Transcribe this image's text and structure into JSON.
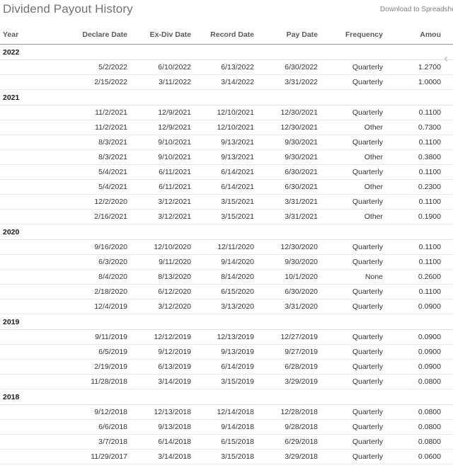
{
  "header": {
    "title": "Dividend Payout History",
    "download_label": "Download to Spreadsheet",
    "scroll_left_icon": "chevron-left-icon",
    "scroll_left_glyph": "‹"
  },
  "colors": {
    "title": "#6d7579",
    "link": "#7b8387",
    "header_text": "#58595b",
    "cell_text": "#333333",
    "year_text": "#1a1a1a",
    "rule": "#9a9a9a",
    "row_border": "#e8e8e8",
    "background": "#ffffff"
  },
  "table": {
    "columns": [
      {
        "key": "year",
        "label": "Year",
        "align": "left"
      },
      {
        "key": "dec",
        "label": "Declare Date",
        "align": "right"
      },
      {
        "key": "exdiv",
        "label": "Ex-Div Date",
        "align": "right"
      },
      {
        "key": "record",
        "label": "Record Date",
        "align": "right"
      },
      {
        "key": "pay",
        "label": "Pay Date",
        "align": "right"
      },
      {
        "key": "freq",
        "label": "Frequency",
        "align": "right"
      },
      {
        "key": "amt",
        "label": "Amou",
        "align": "right",
        "clipped_full_label": "Amount"
      }
    ],
    "groups": [
      {
        "year": "2022",
        "rows": [
          {
            "dec": "5/2/2022",
            "exdiv": "6/10/2022",
            "record": "6/13/2022",
            "pay": "6/30/2022",
            "freq": "Quarterly",
            "amt": "1.2700"
          },
          {
            "dec": "2/15/2022",
            "exdiv": "3/11/2022",
            "record": "3/14/2022",
            "pay": "3/31/2022",
            "freq": "Quarterly",
            "amt": "1.0000"
          }
        ]
      },
      {
        "year": "2021",
        "rows": [
          {
            "dec": "11/2/2021",
            "exdiv": "12/9/2021",
            "record": "12/10/2021",
            "pay": "12/30/2021",
            "freq": "Quarterly",
            "amt": "0.1100"
          },
          {
            "dec": "11/2/2021",
            "exdiv": "12/9/2021",
            "record": "12/10/2021",
            "pay": "12/30/2021",
            "freq": "Other",
            "amt": "0.7300"
          },
          {
            "dec": "8/3/2021",
            "exdiv": "9/10/2021",
            "record": "9/13/2021",
            "pay": "9/30/2021",
            "freq": "Quarterly",
            "amt": "0.1100"
          },
          {
            "dec": "8/3/2021",
            "exdiv": "9/10/2021",
            "record": "9/13/2021",
            "pay": "9/30/2021",
            "freq": "Other",
            "amt": "0.3800"
          },
          {
            "dec": "5/4/2021",
            "exdiv": "6/11/2021",
            "record": "6/14/2021",
            "pay": "6/30/2021",
            "freq": "Quarterly",
            "amt": "0.1100"
          },
          {
            "dec": "5/4/2021",
            "exdiv": "6/11/2021",
            "record": "6/14/2021",
            "pay": "6/30/2021",
            "freq": "Other",
            "amt": "0.2300"
          },
          {
            "dec": "12/2/2020",
            "exdiv": "3/12/2021",
            "record": "3/15/2021",
            "pay": "3/31/2021",
            "freq": "Quarterly",
            "amt": "0.1100"
          },
          {
            "dec": "2/16/2021",
            "exdiv": "3/12/2021",
            "record": "3/15/2021",
            "pay": "3/31/2021",
            "freq": "Other",
            "amt": "0.1900"
          }
        ]
      },
      {
        "year": "2020",
        "rows": [
          {
            "dec": "9/16/2020",
            "exdiv": "12/10/2020",
            "record": "12/11/2020",
            "pay": "12/30/2020",
            "freq": "Quarterly",
            "amt": "0.1100"
          },
          {
            "dec": "6/3/2020",
            "exdiv": "9/11/2020",
            "record": "9/14/2020",
            "pay": "9/30/2020",
            "freq": "Quarterly",
            "amt": "0.1100"
          },
          {
            "dec": "8/4/2020",
            "exdiv": "8/13/2020",
            "record": "8/14/2020",
            "pay": "10/1/2020",
            "freq": "None",
            "amt": "0.2600"
          },
          {
            "dec": "2/18/2020",
            "exdiv": "6/12/2020",
            "record": "6/15/2020",
            "pay": "6/30/2020",
            "freq": "Quarterly",
            "amt": "0.1100"
          },
          {
            "dec": "12/4/2019",
            "exdiv": "3/12/2020",
            "record": "3/13/2020",
            "pay": "3/31/2020",
            "freq": "Quarterly",
            "amt": "0.0900"
          }
        ]
      },
      {
        "year": "2019",
        "rows": [
          {
            "dec": "9/11/2019",
            "exdiv": "12/12/2019",
            "record": "12/13/2019",
            "pay": "12/27/2019",
            "freq": "Quarterly",
            "amt": "0.0900"
          },
          {
            "dec": "6/5/2019",
            "exdiv": "9/12/2019",
            "record": "9/13/2019",
            "pay": "9/27/2019",
            "freq": "Quarterly",
            "amt": "0.0900"
          },
          {
            "dec": "2/19/2019",
            "exdiv": "6/13/2019",
            "record": "6/14/2019",
            "pay": "6/28/2019",
            "freq": "Quarterly",
            "amt": "0.0900"
          },
          {
            "dec": "11/28/2018",
            "exdiv": "3/14/2019",
            "record": "3/15/2019",
            "pay": "3/29/2019",
            "freq": "Quarterly",
            "amt": "0.0800"
          }
        ]
      },
      {
        "year": "2018",
        "rows": [
          {
            "dec": "9/12/2018",
            "exdiv": "12/13/2018",
            "record": "12/14/2018",
            "pay": "12/28/2018",
            "freq": "Quarterly",
            "amt": "0.0800"
          },
          {
            "dec": "6/6/2018",
            "exdiv": "9/13/2018",
            "record": "9/14/2018",
            "pay": "9/28/2018",
            "freq": "Quarterly",
            "amt": "0.0800"
          },
          {
            "dec": "3/7/2018",
            "exdiv": "6/14/2018",
            "record": "6/15/2018",
            "pay": "6/29/2018",
            "freq": "Quarterly",
            "amt": "0.0800"
          },
          {
            "dec": "11/29/2017",
            "exdiv": "3/14/2018",
            "record": "3/15/2018",
            "pay": "3/29/2018",
            "freq": "Quarterly",
            "amt": "0.0600"
          }
        ]
      }
    ]
  }
}
